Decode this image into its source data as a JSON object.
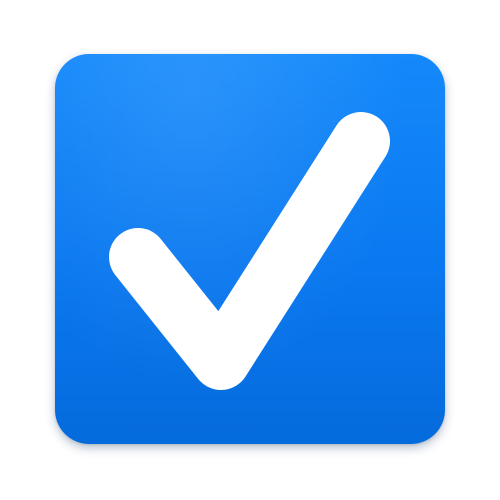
{
  "icon": {
    "name": "checkmark-icon",
    "background_color": "#0a78f0",
    "glyph_color": "#ffffff"
  }
}
